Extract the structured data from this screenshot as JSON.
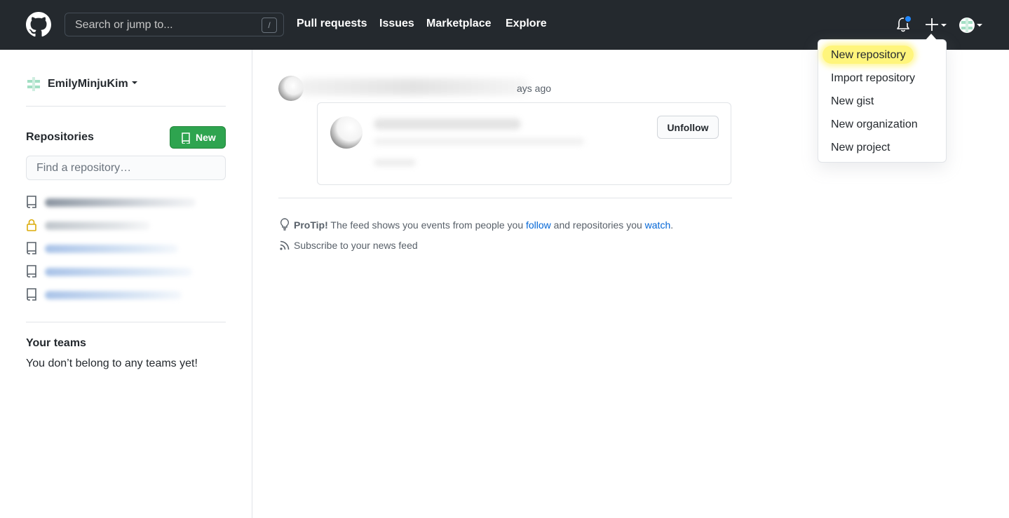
{
  "header": {
    "search_placeholder": "Search or jump to...",
    "search_shortcut": "/",
    "nav": [
      "Pull requests",
      "Issues",
      "Marketplace",
      "Explore"
    ],
    "bell_has_unread": true
  },
  "create_menu": {
    "items": [
      "New repository",
      "Import repository",
      "New gist",
      "New organization",
      "New project"
    ],
    "highlighted": "New repository"
  },
  "sidebar": {
    "username": "EmilyMinjuKim",
    "repositories_title": "Repositories",
    "new_button": "New",
    "find_placeholder": "Find a repository…",
    "teams_title": "Your teams",
    "teams_empty": "You don’t belong to any teams yet!"
  },
  "feed": {
    "event_time": "ays ago",
    "unfollow_label": "Unfollow",
    "protip_label": "ProTip!",
    "protip_pre": " The feed shows you events from people you ",
    "protip_link_follow": "follow",
    "protip_mid": " and repositories you ",
    "protip_link_watch": "watch",
    "protip_end": ".",
    "subscribe": "Subscribe to your news feed"
  },
  "colors": {
    "header_bg": "#24292e",
    "new_button": "#2ea44f",
    "link": "#0366d6",
    "highlight": "#fff150"
  }
}
